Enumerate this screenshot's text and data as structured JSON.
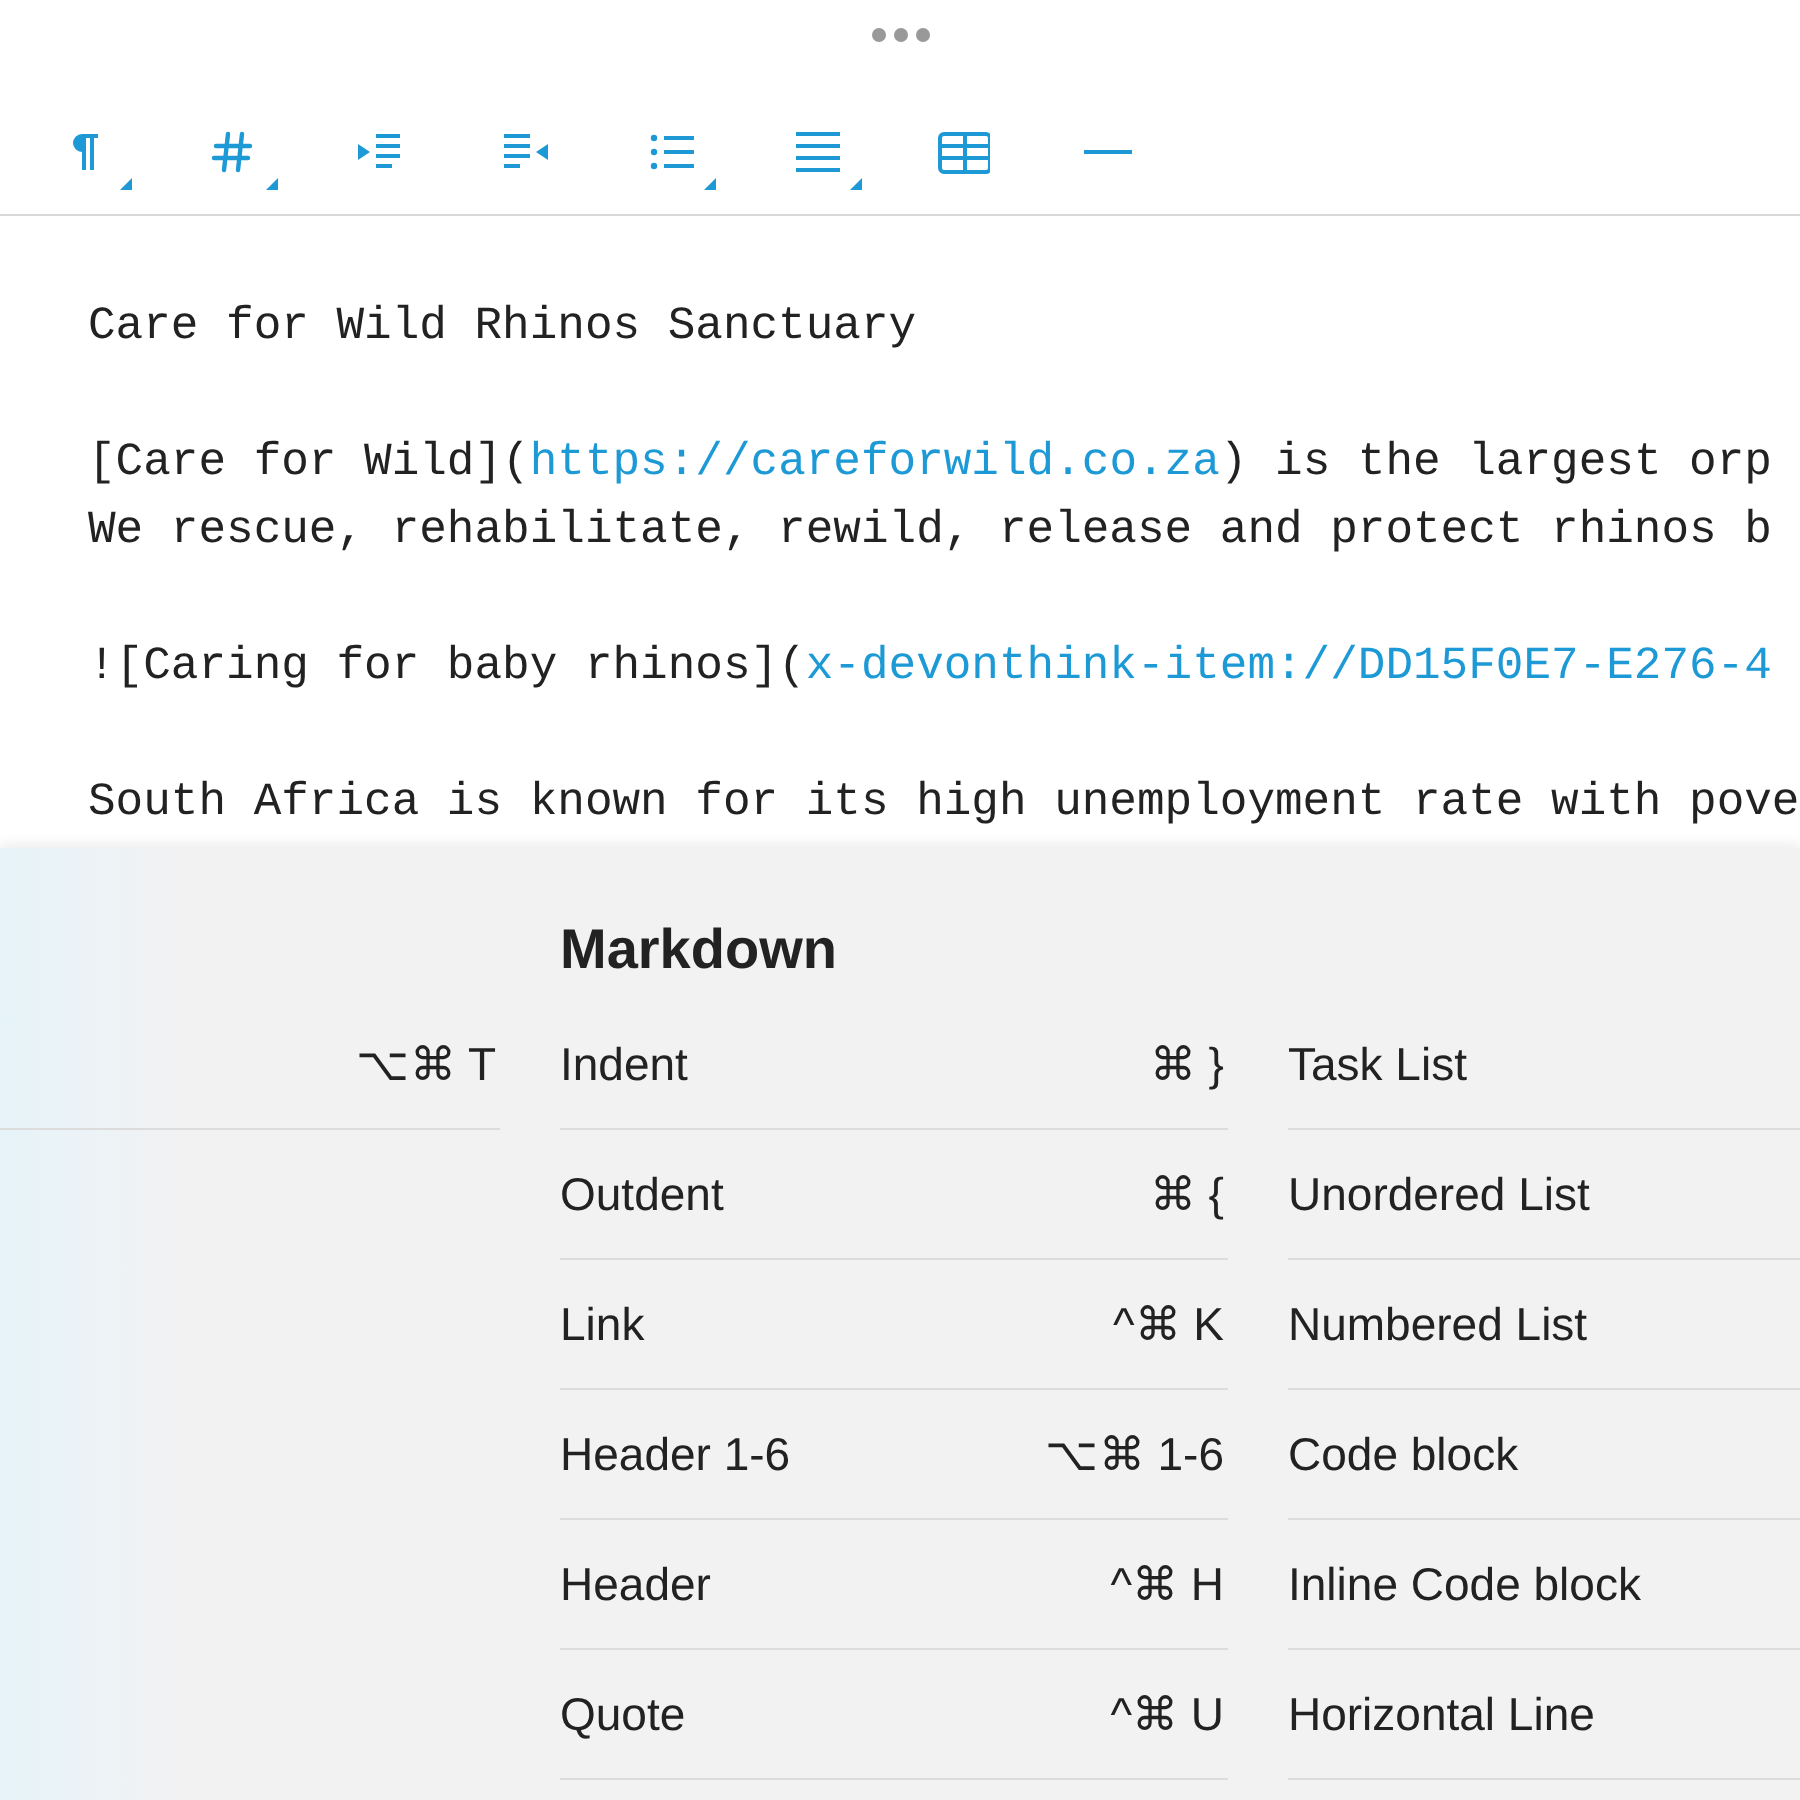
{
  "toolbar": [
    {
      "kind": "paragraph",
      "menu": true
    },
    {
      "kind": "heading",
      "menu": true
    },
    {
      "kind": "indent",
      "menu": false
    },
    {
      "kind": "outdent",
      "menu": false
    },
    {
      "kind": "list",
      "menu": true
    },
    {
      "kind": "align",
      "menu": true
    },
    {
      "kind": "table",
      "menu": false
    },
    {
      "kind": "rule",
      "menu": false
    }
  ],
  "editor": {
    "paragraphs": [
      [
        [
          {
            "kind": "plain",
            "text": "Care for Wild Rhinos Sanctuary"
          }
        ]
      ],
      [
        [
          {
            "kind": "plain",
            "text": "[Care for Wild]("
          },
          {
            "kind": "link",
            "text": "https://careforwild.co.za"
          },
          {
            "kind": "plain",
            "text": ") is the largest orp"
          }
        ],
        [
          {
            "kind": "plain",
            "text": "We rescue, rehabilitate, rewild, release and protect rhinos b"
          }
        ]
      ],
      [
        [
          {
            "kind": "plain",
            "text": "![Caring for baby rhinos]("
          },
          {
            "kind": "link",
            "text": "x-devonthink-item://DD15F0E7-E276-4"
          }
        ]
      ],
      [
        [
          {
            "kind": "plain",
            "text": "South Africa is known for its high unemployment rate with pove"
          }
        ]
      ]
    ]
  },
  "shortcut_panel": {
    "columns": [
      {
        "items": [
          {
            "shortcut": "⌥⌘ T"
          }
        ]
      },
      {
        "title": "Markdown",
        "items": [
          {
            "label": "Indent",
            "shortcut": "⌘ }"
          },
          {
            "label": "Outdent",
            "shortcut": "⌘ {"
          },
          {
            "label": "Link",
            "shortcut": "^⌘ K"
          },
          {
            "label": "Header 1-6",
            "shortcut": "⌥⌘ 1-6"
          },
          {
            "label": "Header",
            "shortcut": "^⌘ H"
          },
          {
            "label": "Quote",
            "shortcut": "^⌘ U"
          }
        ]
      },
      {
        "items": [
          {
            "label": "Task List"
          },
          {
            "label": "Unordered List"
          },
          {
            "label": "Numbered List"
          },
          {
            "label": "Code block"
          },
          {
            "label": "Inline Code block"
          },
          {
            "label": "Horizontal Line"
          }
        ]
      }
    ]
  }
}
